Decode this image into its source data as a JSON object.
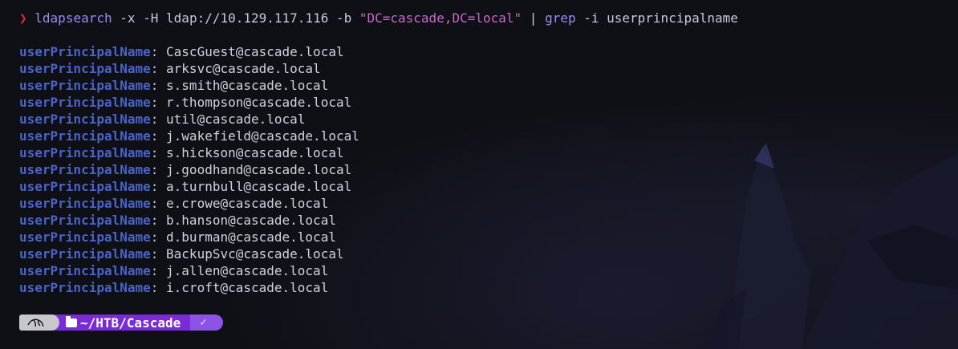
{
  "command": {
    "prompt_symbol": "❯",
    "tool": "ldapsearch",
    "args1": " -x -H ldap://10.129.117.116 -b ",
    "base_dn": "\"DC=cascade,DC=local\"",
    "pipe": " | ",
    "grep": "grep",
    "grep_args": " -i userprincipalname"
  },
  "output": {
    "attribute": "userPrincipalName",
    "separator": ": ",
    "values": [
      "CascGuest@cascade.local",
      "arksvc@cascade.local",
      "s.smith@cascade.local",
      "r.thompson@cascade.local",
      "util@cascade.local",
      "j.wakefield@cascade.local",
      "s.hickson@cascade.local",
      "j.goodhand@cascade.local",
      "a.turnbull@cascade.local",
      "e.crowe@cascade.local",
      "b.hanson@cascade.local",
      "d.burman@cascade.local",
      "BackupSvc@cascade.local",
      "j.allen@cascade.local",
      "i.croft@cascade.local"
    ]
  },
  "prompt": {
    "os_icon": "kali-dragon-icon",
    "folder_icon": "folder-open-icon",
    "path_prefix": "~/HTB/",
    "path_dir": "Cascade",
    "status_glyph": "✓"
  },
  "colors": {
    "background": "#0f1015",
    "prompt_arrow": "#e0264b",
    "command": "#9b8cf2",
    "string": "#c76ac6",
    "attribute_key": "#4a63c9",
    "path_segment": "#7a2bd6",
    "status_segment": "#8d52e6",
    "os_segment": "#c8c8cc"
  }
}
